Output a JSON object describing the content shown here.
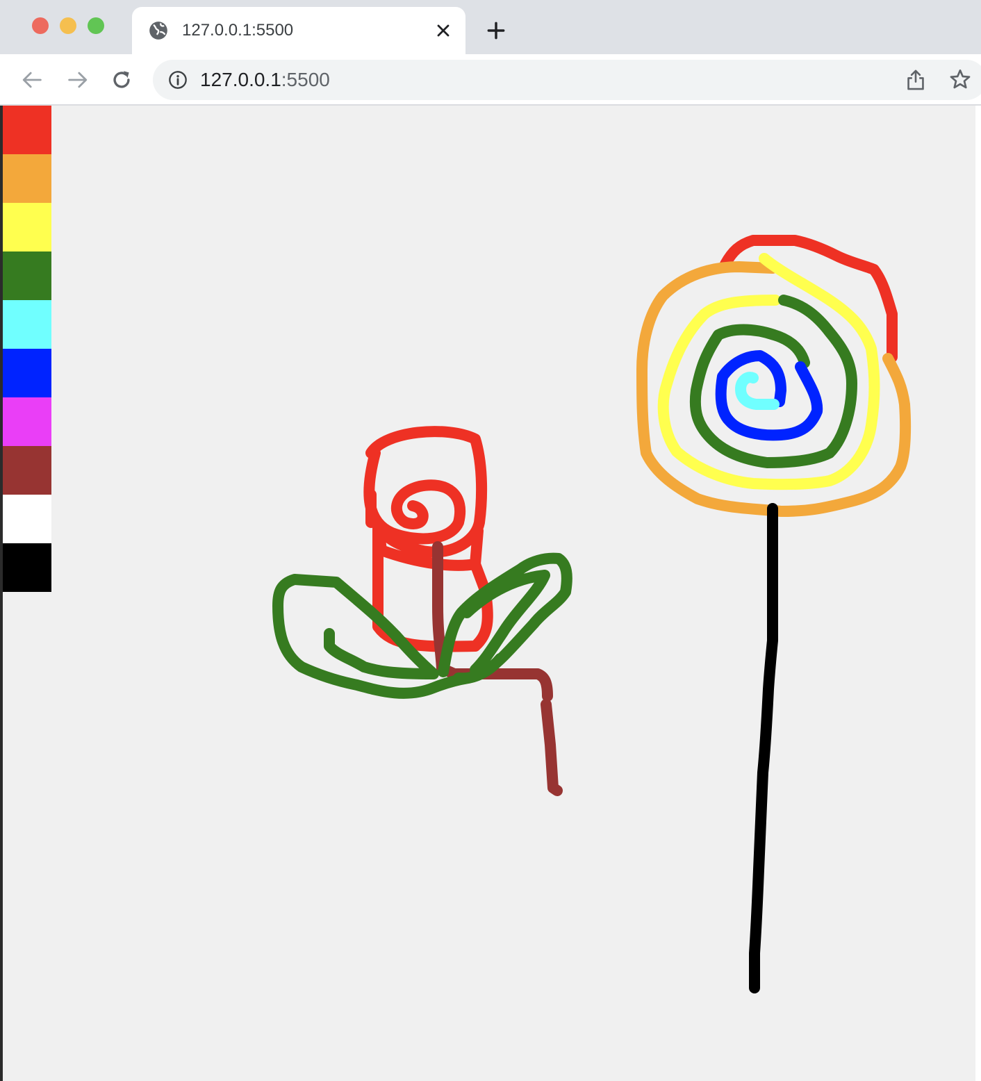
{
  "browser": {
    "tab_title": "127.0.0.1:5500",
    "url_host": "127.0.0.1",
    "url_port": ":5500"
  },
  "palette": {
    "colors": [
      "#ee3124",
      "#f3a83b",
      "#ffff4f",
      "#367b20",
      "#70ffff",
      "#0023ff",
      "#ea3ef7",
      "#973432",
      "#ffffff",
      "#000000"
    ]
  },
  "drawing": {
    "background": "#f0f0f0"
  }
}
